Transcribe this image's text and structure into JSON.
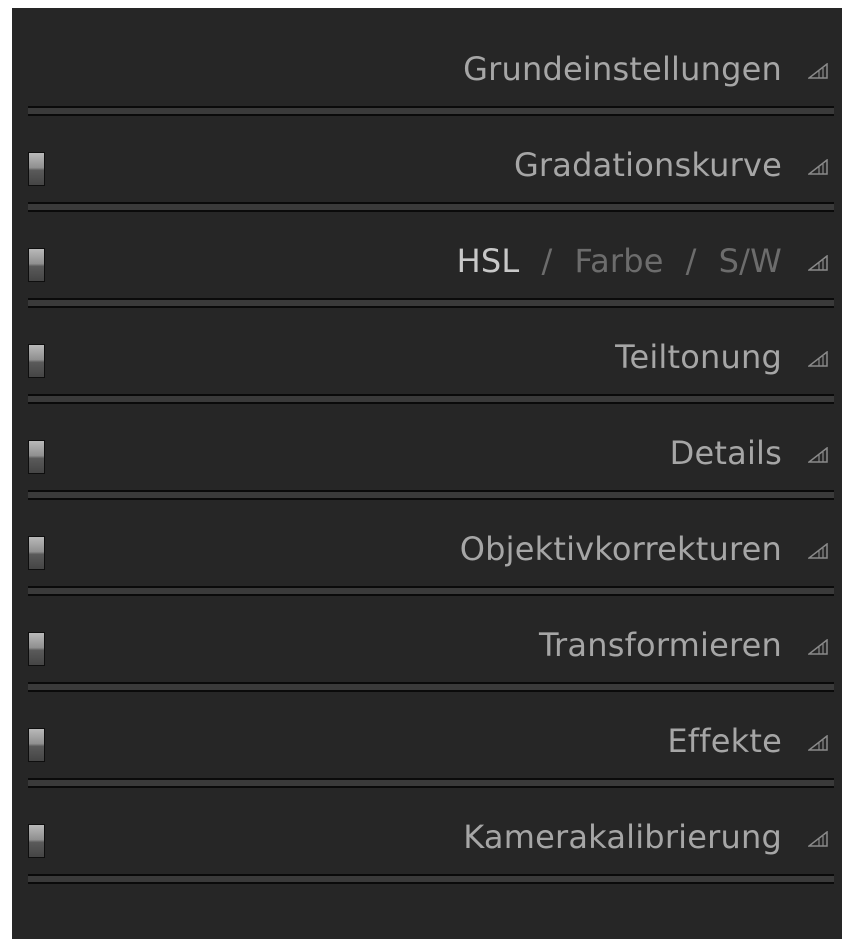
{
  "panels": [
    {
      "label": "Grundeinstellungen",
      "has_toggle": false
    },
    {
      "label": "Gradationskurve",
      "has_toggle": true
    },
    {
      "label_parts": [
        "HSL",
        "/",
        "Farbe",
        "/",
        "S/W"
      ],
      "has_toggle": true
    },
    {
      "label": "Teiltonung",
      "has_toggle": true
    },
    {
      "label": "Details",
      "has_toggle": true
    },
    {
      "label": "Objektivkorrekturen",
      "has_toggle": true
    },
    {
      "label": "Transformieren",
      "has_toggle": true
    },
    {
      "label": "Effekte",
      "has_toggle": true
    },
    {
      "label": "Kamerakalibrierung",
      "has_toggle": true
    }
  ],
  "icons": {
    "toggle": "panel-toggle-switch",
    "arrow": "collapse-arrow-icon"
  },
  "colors": {
    "background": "#262626",
    "text": "#a6a6a6",
    "text_active": "#c8c8c8",
    "text_dim": "#6c6c6c"
  }
}
